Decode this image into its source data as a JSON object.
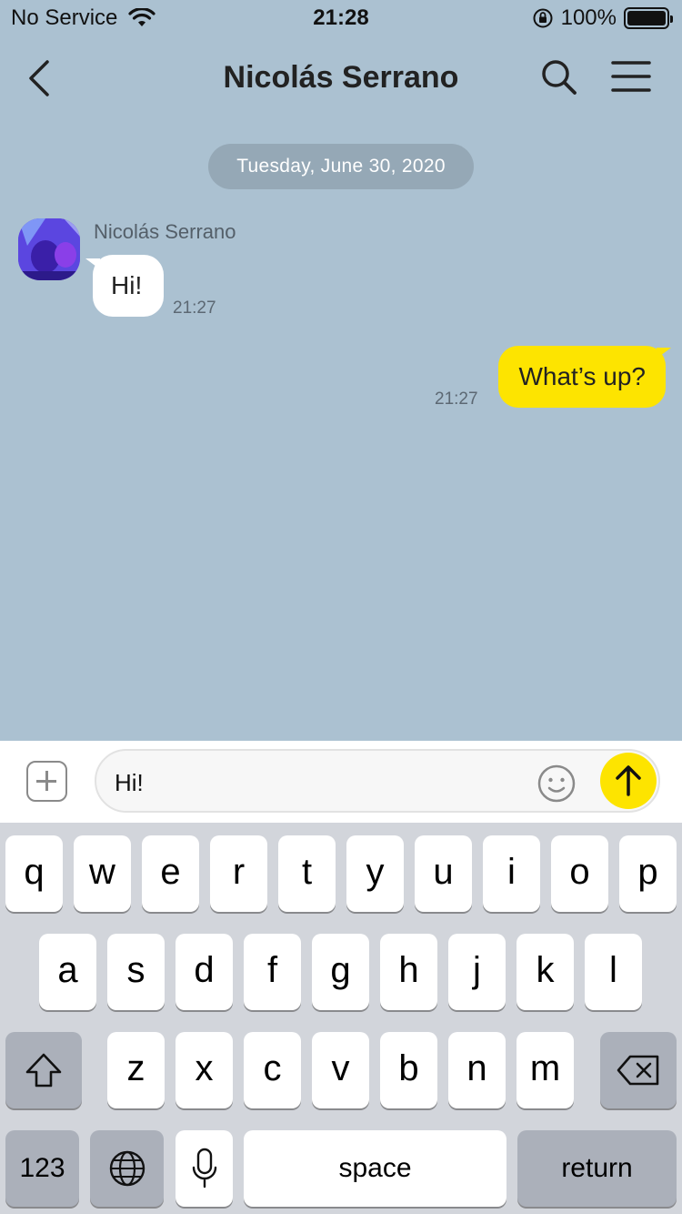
{
  "status_bar": {
    "carrier": "No Service",
    "time": "21:28",
    "battery": "100%",
    "battery_level": 1.0
  },
  "header": {
    "title": "Nicolás Serrano",
    "back_icon": "chevron-left-icon",
    "search_icon": "search-icon",
    "menu_icon": "hamburger-menu-icon"
  },
  "chat": {
    "date": "Tuesday, June 30, 2020",
    "messages": [
      {
        "direction": "incoming",
        "sender": "Nicolás Serrano",
        "text": "Hi!",
        "time": "21:27"
      },
      {
        "direction": "outgoing",
        "text": "What’s up?",
        "time": "21:27"
      }
    ]
  },
  "composer": {
    "value": "Hi!",
    "plus_icon": "plus-square-icon",
    "emoji_icon": "emoji-icon",
    "send_icon": "arrow-up-icon"
  },
  "keyboard": {
    "row1": [
      "q",
      "w",
      "e",
      "r",
      "t",
      "y",
      "u",
      "i",
      "o",
      "p"
    ],
    "row2": [
      "a",
      "s",
      "d",
      "f",
      "g",
      "h",
      "j",
      "k",
      "l"
    ],
    "row3": [
      "z",
      "x",
      "c",
      "v",
      "b",
      "n",
      "m"
    ],
    "numbers": "123",
    "space": "space",
    "return": "return",
    "shift_icon": "shift-icon",
    "backspace_icon": "backspace-icon",
    "globe_icon": "globe-icon",
    "mic_icon": "microphone-icon"
  },
  "colors": {
    "chat_background": "#abc1d1",
    "outgoing_bubble": "#fde400",
    "incoming_bubble": "#ffffff",
    "send_button": "#fde400",
    "keyboard_background": "#d2d5db"
  }
}
